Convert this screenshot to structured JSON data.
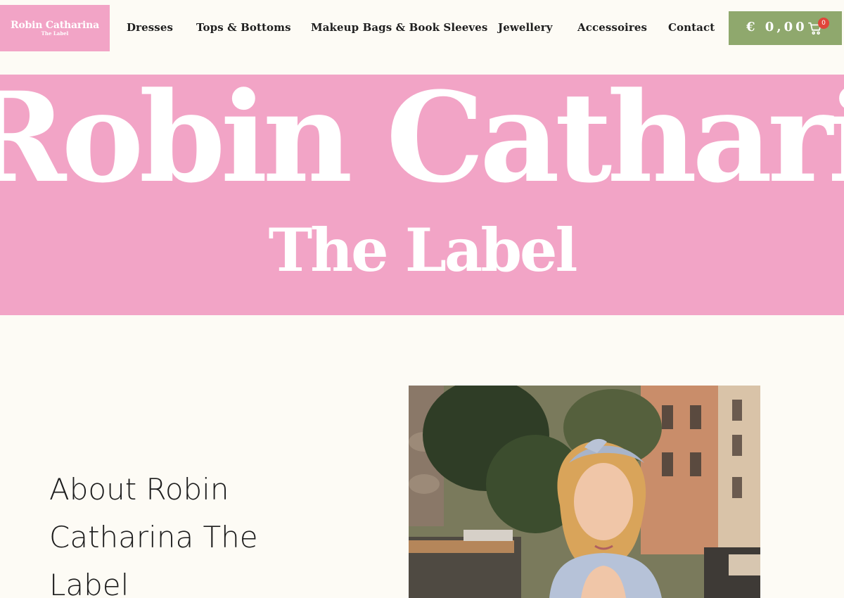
{
  "logo": {
    "line1": "Robin Catharina",
    "line2": "The Label"
  },
  "nav": [
    {
      "label": "Dresses"
    },
    {
      "label": "Tops & Bottoms"
    },
    {
      "label": "Makeup Bags & Book Sleeves"
    },
    {
      "label": "Jewellery"
    },
    {
      "label": "Accessoires"
    },
    {
      "label": "Contact"
    }
  ],
  "cart": {
    "amount": "€ 0,00",
    "count": "0",
    "icon": "cart-icon"
  },
  "hero": {
    "title": "Robin Catharina",
    "subtitle": "The Label"
  },
  "about": {
    "heading_line1": "About Robin",
    "heading_line2": "Catharina The",
    "heading_line3": "Label"
  },
  "colors": {
    "pink": "#f2a4c6",
    "green": "#8fa86d",
    "background": "#fdfbf5",
    "badge": "#e0453a"
  }
}
